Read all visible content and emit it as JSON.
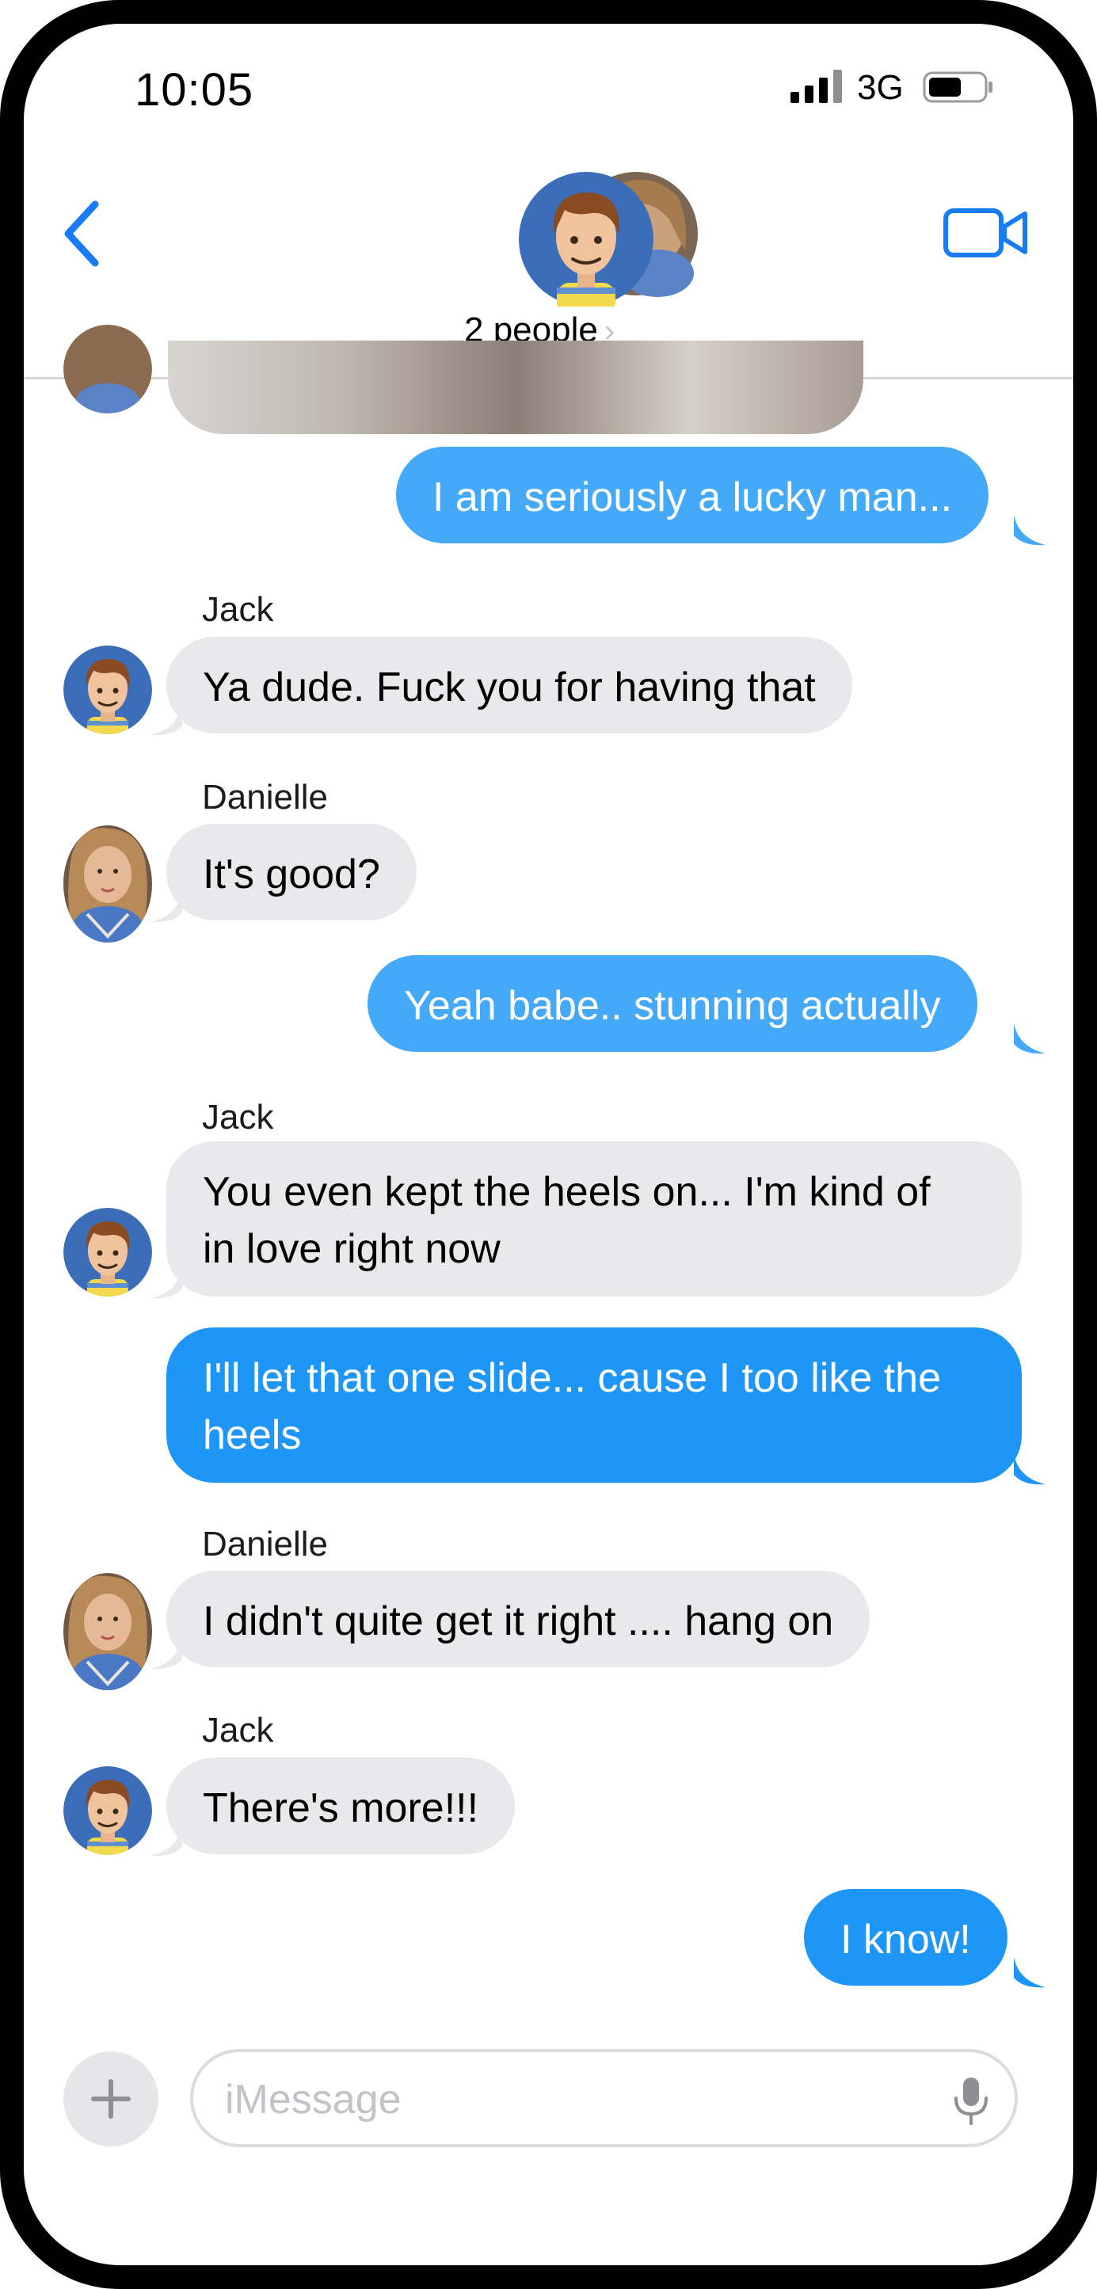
{
  "status_bar": {
    "time": "10:05",
    "network": "3G"
  },
  "header": {
    "people_label": "2 people",
    "people_chevron": "›"
  },
  "messages": [
    {
      "side": "out",
      "text": "I am seriously a lucky man..."
    },
    {
      "side": "in",
      "sender": "Jack",
      "text": "Ya dude.  Fuck you for having that"
    },
    {
      "side": "in",
      "sender": "Danielle",
      "text": "It's good?"
    },
    {
      "side": "out",
      "text": "Yeah babe.. stunning actually"
    },
    {
      "side": "in",
      "sender": "Jack",
      "line1": "You even kept the heels on...  I'm kind of",
      "line2": "in love right now"
    },
    {
      "side": "out",
      "line1": "I'll let that one slide... cause I too like the",
      "line2": "heels"
    },
    {
      "side": "in",
      "sender": "Danielle",
      "text": "I didn't quite get it right .... hang on"
    },
    {
      "side": "in",
      "sender": "Jack",
      "text": "There's more!!!"
    },
    {
      "side": "out",
      "text": "I know!"
    }
  ],
  "composer": {
    "placeholder": "iMessage"
  },
  "colors": {
    "accent": "#1e96f8",
    "incoming": "#e9e9eb",
    "ios_blue": "#1a7cf5"
  }
}
